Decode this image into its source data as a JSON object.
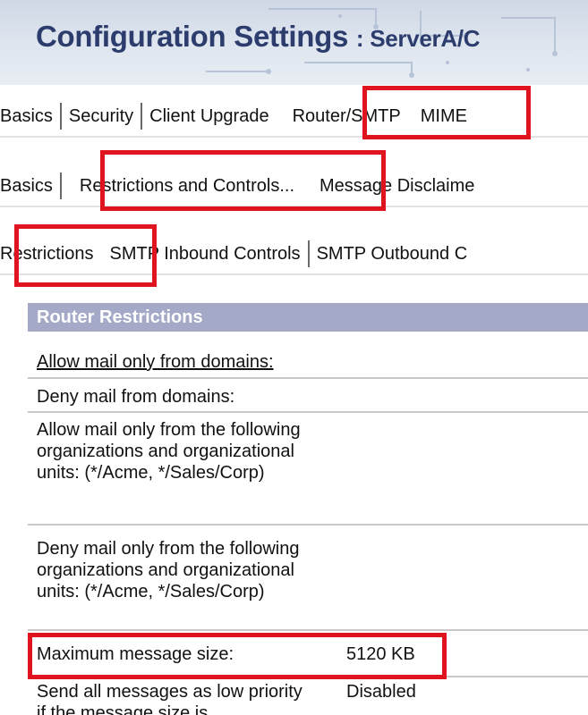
{
  "banner": {
    "title": "Configuration Settings",
    "subtitle": ": ServerA/C"
  },
  "main_tabs": [
    "Basics",
    "Security",
    "Client Upgrade",
    "Router/SMTP",
    "MIME"
  ],
  "router_tabs": [
    "Basics",
    "Restrictions and Controls...",
    "Message Disclaime"
  ],
  "restriction_tabs": [
    "Restrictions",
    "SMTP Inbound Controls",
    "SMTP Outbound C"
  ],
  "section": {
    "title": "Router Restrictions"
  },
  "fields": [
    {
      "label": "Allow mail only from domains:",
      "value": ""
    },
    {
      "label": "Deny mail from domains:",
      "value": ""
    },
    {
      "label": "Allow mail only from the following organizations and organizational units: (*/Acme, */Sales/Corp)",
      "value": ""
    },
    {
      "label": "Deny mail only from the following organizations and organizational units: (*/Acme, */Sales/Corp)",
      "value": ""
    },
    {
      "label": "Maximum message size:",
      "value": "5120 KB"
    },
    {
      "label": "Send all messages as low priority if the message size is",
      "value": "Disabled"
    }
  ],
  "colors": {
    "banner_title": "#2c3c6c",
    "section_header_bg": "#a3a9c6",
    "highlight": "#e0141e"
  }
}
